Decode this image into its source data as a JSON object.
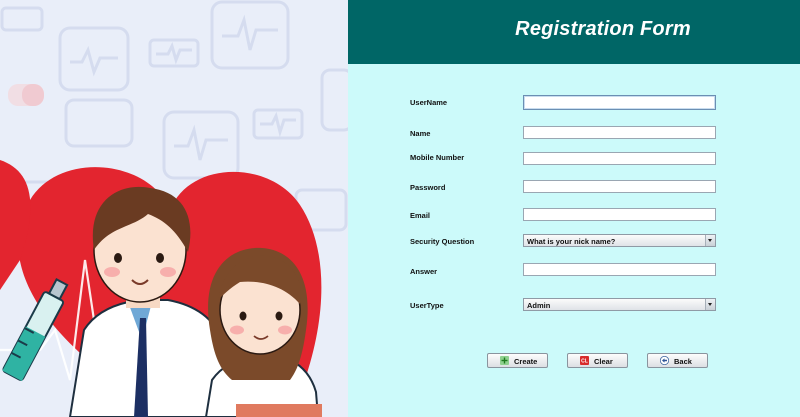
{
  "form": {
    "title": "Registration Form",
    "fields": {
      "username": {
        "label": "UserName",
        "value": ""
      },
      "name": {
        "label": "Name",
        "value": ""
      },
      "mobile": {
        "label": "Mobile Number",
        "value": ""
      },
      "password": {
        "label": "Password",
        "value": ""
      },
      "email": {
        "label": "Email",
        "value": ""
      },
      "security_question": {
        "label": "Security Question",
        "value": "What is your nick name?"
      },
      "answer": {
        "label": "Answer",
        "value": ""
      },
      "usertype": {
        "label": "UserType",
        "value": "Admin"
      }
    },
    "buttons": {
      "create": {
        "label": "Create",
        "icon": "plus-icon"
      },
      "clear": {
        "label": "Clear",
        "icon": "clear-icon"
      },
      "back": {
        "label": "Back",
        "icon": "back-arrow-icon"
      }
    }
  },
  "colors": {
    "header": "#006666",
    "panel": "#ccfafa",
    "heart": "#e3252f",
    "illustration_bg": "#e9eef9"
  }
}
